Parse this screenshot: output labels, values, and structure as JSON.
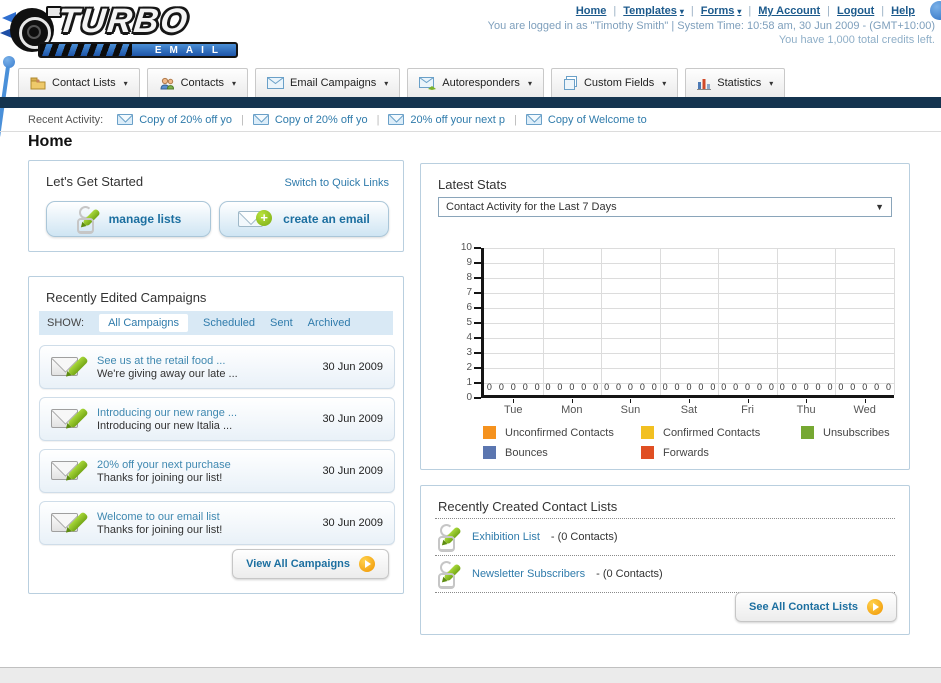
{
  "header": {
    "logo_title": "TURBO",
    "logo_subtitle": "EMAIL",
    "top_links": [
      {
        "label": "Home",
        "dropdown": false
      },
      {
        "label": "Templates",
        "dropdown": true
      },
      {
        "label": "Forms",
        "dropdown": true
      },
      {
        "label": "My Account",
        "dropdown": false
      },
      {
        "label": "Logout",
        "dropdown": false
      },
      {
        "label": "Help",
        "dropdown": false
      }
    ],
    "login_info": "You are logged in as \"Timothy Smith\" | System Time: 10:58 am, 30 Jun 2009 - (GMT+10:00)",
    "credits_info": "You have 1,000 total credits left."
  },
  "nav": {
    "tabs": [
      {
        "label": "Contact Lists",
        "icon": "contact-lists-folder-icon"
      },
      {
        "label": "Contacts",
        "icon": "contacts-people-icon"
      },
      {
        "label": "Email Campaigns",
        "icon": "email-envelope-icon"
      },
      {
        "label": "Autoresponders",
        "icon": "autoresponder-envelope-icon"
      },
      {
        "label": "Custom Fields",
        "icon": "custom-fields-pages-icon"
      },
      {
        "label": "Statistics",
        "icon": "statistics-chart-icon"
      }
    ]
  },
  "recent_activity": {
    "label": "Recent Activity:",
    "items": [
      "Copy of 20% off yo",
      "Copy of 20% off yo",
      "20% off your next p",
      "Copy of Welcome to"
    ]
  },
  "home": {
    "title": "Home"
  },
  "get_started": {
    "title": "Let's Get Started",
    "switch_link": "Switch to Quick Links",
    "buttons": {
      "0": {
        "label": "manage lists"
      },
      "1": {
        "label": "create an email"
      }
    }
  },
  "campaigns": {
    "title": "Recently Edited Campaigns",
    "show_label": "SHOW:",
    "tabs": [
      "All Campaigns",
      "Scheduled",
      "Sent",
      "Archived"
    ],
    "active_tab": "All Campaigns",
    "items": [
      {
        "title": "See us at the retail food ...",
        "subtitle": "We're giving away our late ...",
        "date": "30 Jun 2009"
      },
      {
        "title": "Introducing our new range ...",
        "subtitle": "Introducing our new Italia ...",
        "date": "30 Jun 2009"
      },
      {
        "title": "20% off your next purchase",
        "subtitle": "Thanks for joining our list!",
        "date": "30 Jun 2009"
      },
      {
        "title": "Welcome to our email list",
        "subtitle": "Thanks for joining our list!",
        "date": "30 Jun 2009"
      }
    ],
    "view_all": "View All Campaigns"
  },
  "stats": {
    "title": "Latest Stats",
    "selector": "Contact Activity for the Last 7 Days"
  },
  "chart_data": {
    "type": "bar",
    "title": "Contact Activity for the Last 7 Days",
    "categories": [
      "Tue",
      "Mon",
      "Sun",
      "Sat",
      "Fri",
      "Thu",
      "Wed"
    ],
    "series": [
      {
        "name": "Unconfirmed Contacts",
        "color": "#F5921E",
        "values": [
          0,
          0,
          0,
          0,
          0,
          0,
          0
        ]
      },
      {
        "name": "Confirmed Contacts",
        "color": "#F2C021",
        "values": [
          0,
          0,
          0,
          0,
          0,
          0,
          0
        ]
      },
      {
        "name": "Unsubscribes",
        "color": "#76A832",
        "values": [
          0,
          0,
          0,
          0,
          0,
          0,
          0
        ]
      },
      {
        "name": "Bounces",
        "color": "#5B76B0",
        "values": [
          0,
          0,
          0,
          0,
          0,
          0,
          0
        ]
      },
      {
        "name": "Forwards",
        "color": "#E04F23",
        "values": [
          0,
          0,
          0,
          0,
          0,
          0,
          0
        ]
      }
    ],
    "ylim": [
      0,
      10
    ],
    "ytick_step": 1,
    "grid": true,
    "legend_position": "bottom"
  },
  "contact_lists": {
    "title": "Recently Created Contact Lists",
    "items": [
      {
        "name": "Exhibition List",
        "count": "(0 Contacts)"
      },
      {
        "name": "Newsletter Subscribers",
        "count": "(0 Contacts)"
      }
    ],
    "see_all": "See All Contact Lists"
  }
}
